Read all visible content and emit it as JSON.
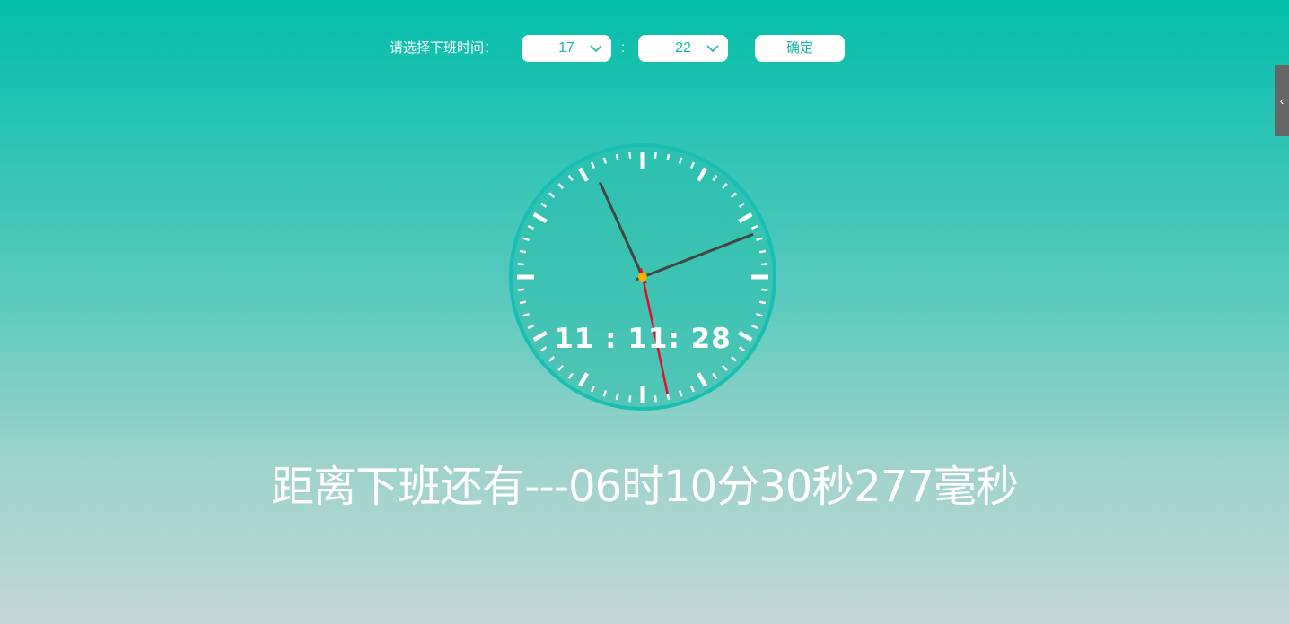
{
  "toolbar": {
    "label": "请选择下班时间：",
    "hour_value": "17",
    "separator": ":",
    "minute_value": "22",
    "confirm_label": "确定"
  },
  "side_tab": {
    "icon": "chevron-left-icon",
    "glyph": "‹"
  },
  "clock": {
    "hours": 11,
    "minutes": 11,
    "seconds": 28,
    "digital_text": "11 : 11: 28",
    "face_color": "#3ec4b5",
    "rim_color": "#18bfb0",
    "tick_color": "#ffffff",
    "hand_color": "#444444",
    "second_hand_color": "#e0102a",
    "center_color": "#f5b400"
  },
  "countdown": {
    "text": "距离下班还有---06时10分30秒277毫秒"
  },
  "colors": {
    "gradient_top": "#04bfa9",
    "gradient_bottom": "#c3d7d6",
    "accent_text": "#1bb9a8"
  }
}
